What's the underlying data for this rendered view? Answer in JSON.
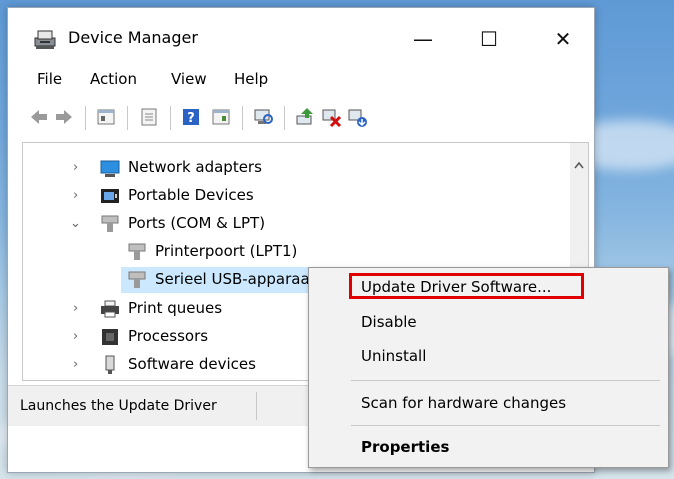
{
  "window": {
    "title": "Device Manager",
    "controls": {
      "minimize": "—",
      "maximize": "☐",
      "close": "✕"
    }
  },
  "menu": [
    "File",
    "Action",
    "View",
    "Help"
  ],
  "toolbar": {
    "icons": [
      "back-icon",
      "forward-icon",
      "properties-icon",
      "show-hidden-icon",
      "help-icon",
      "action-pane-icon",
      "scan-icon",
      "update-driver-icon",
      "uninstall-icon",
      "enable-icon"
    ]
  },
  "tree": {
    "items": [
      {
        "label": "Network adapters",
        "icon": "network-adapter-icon",
        "expander": "collapsed"
      },
      {
        "label": "Portable Devices",
        "icon": "portable-devices-icon",
        "expander": "collapsed"
      },
      {
        "label": "Ports (COM & LPT)",
        "icon": "port-icon",
        "expander": "expanded"
      },
      {
        "label": "Printerpoort (LPT1)",
        "icon": "port-icon",
        "expander": "none"
      },
      {
        "label": "Serieel USB-apparaat",
        "icon": "port-icon",
        "expander": "none",
        "selected": true
      },
      {
        "label": "Print queues",
        "icon": "printer-icon",
        "expander": "collapsed"
      },
      {
        "label": "Processors",
        "icon": "processor-icon",
        "expander": "collapsed"
      },
      {
        "label": "Software devices",
        "icon": "software-device-icon",
        "expander": "collapsed"
      }
    ]
  },
  "status": {
    "text": "Launches the Update Driver"
  },
  "context_menu": {
    "items": [
      {
        "label": "Update Driver Software...",
        "highlighted": true
      },
      {
        "label": "Disable"
      },
      {
        "label": "Uninstall"
      },
      {
        "label": "Scan for hardware changes"
      },
      {
        "label": "Properties",
        "bold": true
      }
    ],
    "highlight_color": "#e00000"
  }
}
